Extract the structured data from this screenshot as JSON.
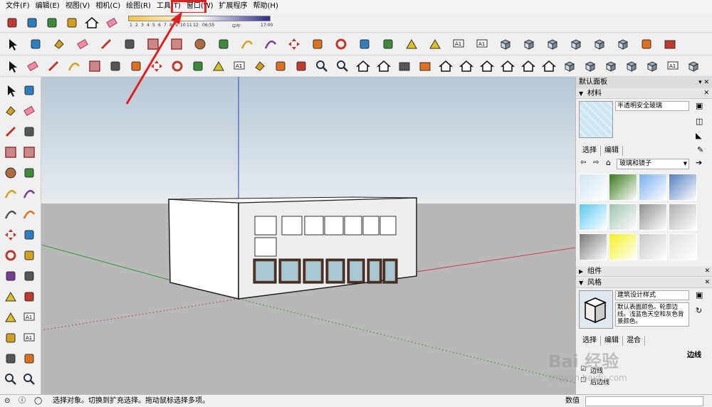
{
  "menubar": {
    "items": [
      "文件(F)",
      "编辑(E)",
      "视图(V)",
      "相机(C)",
      "绘图(R)",
      "工具(T)",
      "窗口(W)",
      "扩展程序",
      "帮助(H)"
    ],
    "highlight_color": "#e02020"
  },
  "shadow": {
    "hours": [
      "1",
      "2",
      "3",
      "4",
      "5",
      "6",
      "7",
      "8",
      "9",
      "10",
      "11",
      "12"
    ],
    "time_start": "06:55",
    "time_mid": "中午",
    "time_end": "17:00"
  },
  "icons": {
    "row1": [
      "component-icon",
      "check-icon",
      "cloud-upload-icon",
      "extension-link-icon",
      "warehouse-icon",
      "eraser-style-icon"
    ],
    "row2": [
      "select-icon",
      "make-component-icon",
      "paint-bucket-icon",
      "eraser-icon",
      "pencil-icon",
      "freehand-icon",
      "rectangle-icon",
      "rotated-rectangle-icon",
      "circle-icon",
      "polygon-icon",
      "arc-icon",
      "pie-icon",
      "move-icon",
      "push-pull-icon",
      "rotate-icon",
      "scale-icon",
      "follow-me-icon",
      "tape-icon",
      "protractor-icon",
      "text-icon",
      "3d-text-icon",
      "iso-icon",
      "top-view-icon",
      "front-view-icon",
      "right-view-icon",
      "back-view-icon",
      "left-view-icon",
      "styles-icon",
      "ruby-icon"
    ],
    "row3": [
      "select-icon",
      "eraser-icon",
      "pencil-icon",
      "arc-icon",
      "rectangle-icon",
      "push-pull-icon",
      "follow-me-icon",
      "move-icon",
      "rotate-icon",
      "scale-icon",
      "tape-icon",
      "text-icon",
      "paint-bucket-icon",
      "orbit-icon",
      "pan-icon",
      "zoom-icon",
      "zoom-extents-icon",
      "warehouse-icon",
      "ext-warehouse-icon",
      "share-icon",
      "ruby-icon",
      "house-icon",
      "house2-icon",
      "house3-icon",
      "house4-icon",
      "house5-icon",
      "house6-icon",
      "section-icon",
      "xray-icon",
      "wire-icon",
      "hidden-icon",
      "shaded-icon",
      "textured-icon",
      "mono-icon"
    ],
    "palette": [
      "select-icon",
      "make-component-icon",
      "paint-bucket-icon",
      "eraser-icon",
      "pencil-icon",
      "freehand-icon",
      "rectangle-icon",
      "rotated-rectangle-icon",
      "circle-icon",
      "polygon-icon",
      "arc-icon",
      "arc3-icon",
      "arc2-icon",
      "pie-icon",
      "move-icon",
      "push-pull-icon",
      "rotate-icon",
      "follow-me-icon",
      "scale-icon",
      "offset-icon",
      "tape-icon",
      "dimension-icon",
      "protractor-icon",
      "text-icon",
      "axes-icon",
      "3d-text-icon",
      "orbit-icon",
      "pan-icon",
      "zoom-icon",
      "zoom-window-icon"
    ]
  },
  "panel": {
    "title": "默认面板",
    "controls": "▾ ✕",
    "materials": {
      "header": "材料",
      "name": "半透明安全玻璃",
      "tabs": [
        "选择",
        "编辑"
      ],
      "library": "玻璃和镜子",
      "swatch_colors": [
        "#cfe8f5",
        "#3a7a1a",
        "#7ab0ef",
        "#5580c0",
        "#5ccaf0",
        "#a0c4b0",
        "#909090",
        "#b0b0b0",
        "#7a7a7a",
        "#f5f020",
        "#c8c8c8",
        "#e0e0e0"
      ]
    },
    "components": {
      "header": "组件"
    },
    "styles": {
      "header": "风格",
      "name": "建筑设计样式",
      "desc": "默认表面颜色。轮廓边线。浅蓝色天空和灰色背景颜色。",
      "tabs": [
        "选择",
        "编辑",
        "混合"
      ],
      "edges_label": "边线",
      "chk1": "边线",
      "chk2": "后边线"
    }
  },
  "status": {
    "message": "选择对象。切换到扩充选择。拖动鼠标选择多项。",
    "measure_label": "数值"
  },
  "watermark": {
    "text": "Bai 经验",
    "sub": "jingyan.baidu.com"
  },
  "colors": {
    "sky_top": "#b6c8d6",
    "sky_bottom": "#e6ebef",
    "ground": "#b8b8b8",
    "axis_red": "#d04040",
    "axis_green": "#30a030",
    "axis_blue": "#3040c0"
  }
}
